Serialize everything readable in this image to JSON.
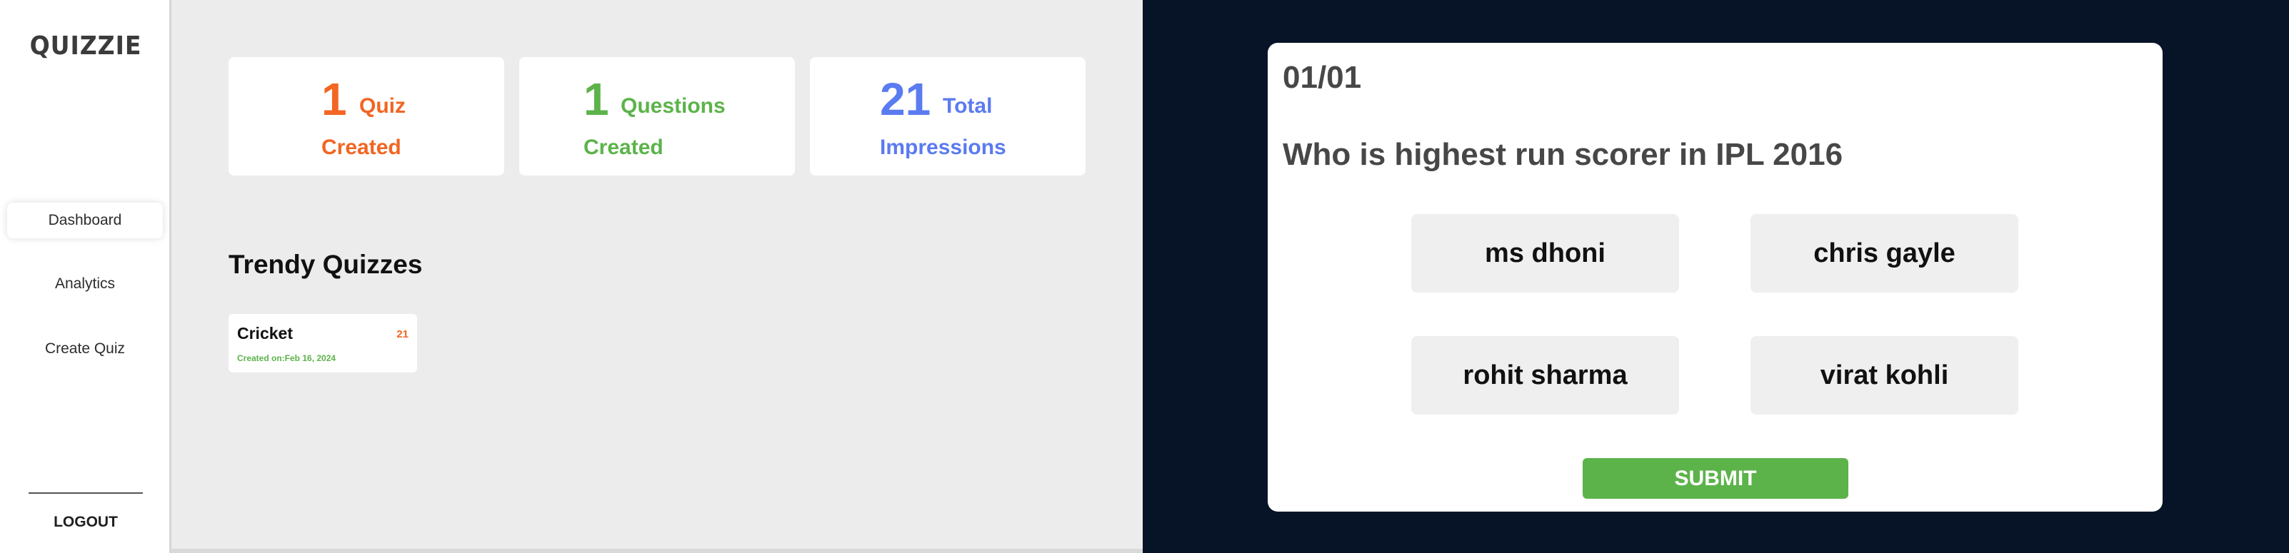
{
  "sidebar": {
    "logo": "QUIZZIE",
    "items": [
      {
        "label": "Dashboard"
      },
      {
        "label": "Analytics"
      },
      {
        "label": "Create Quiz"
      }
    ],
    "logout": "LOGOUT"
  },
  "stats": [
    {
      "value": "1",
      "label_top": "Quiz",
      "label_bottom": "Created",
      "color": "#f26522"
    },
    {
      "value": "1",
      "label_top": "Questions",
      "label_bottom": "Created",
      "color": "#5cb34a"
    },
    {
      "value": "21",
      "label_top": "Total",
      "label_bottom": "Impressions",
      "color": "#5b7bf0"
    }
  ],
  "trendy": {
    "title": "Trendy Quizzes",
    "cards": [
      {
        "name": "Cricket",
        "count": "21",
        "date": "Created on:Feb 16, 2024"
      }
    ]
  },
  "quiz_modal": {
    "counter": "01/01",
    "question": "Who is highest run scorer in IPL 2016",
    "options": [
      "ms dhoni",
      "chris gayle",
      "rohit sharma",
      "virat kohli"
    ],
    "submit": "SUBMIT"
  },
  "colors": {
    "overlay_bg": "#071427",
    "submit_bg": "#5cb34a"
  }
}
